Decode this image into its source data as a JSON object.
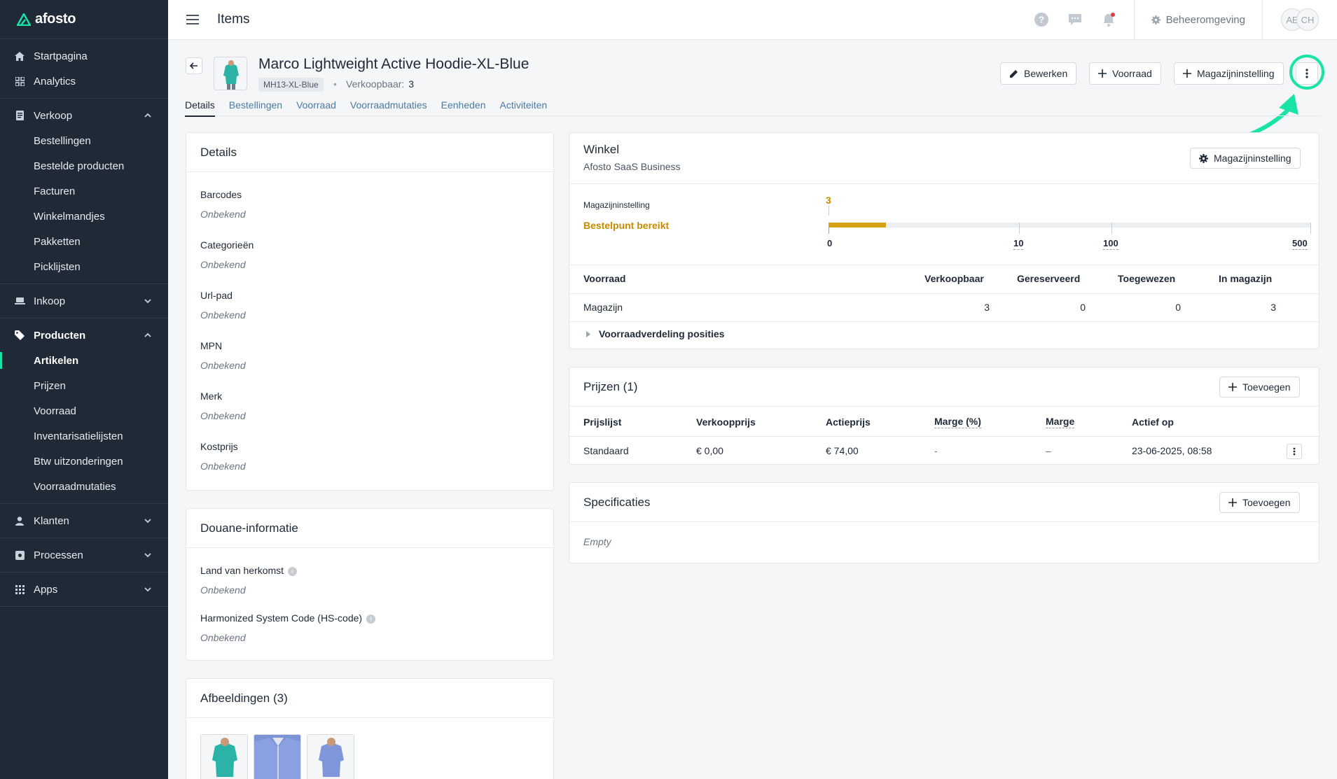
{
  "app": {
    "logo_text": "afosto"
  },
  "sidebar": {
    "items": [
      {
        "label": "Startpagina",
        "icon": "home-icon"
      },
      {
        "label": "Analytics",
        "icon": "analytics-icon"
      },
      {
        "label": "Verkoop",
        "icon": "receipt-icon",
        "expanded": true
      },
      {
        "label": "Bestellingen"
      },
      {
        "label": "Bestelde producten"
      },
      {
        "label": "Facturen"
      },
      {
        "label": "Winkelmandjes"
      },
      {
        "label": "Pakketten"
      },
      {
        "label": "Picklijsten"
      },
      {
        "label": "Inkoop",
        "icon": "truck-icon",
        "expanded": false
      },
      {
        "label": "Producten",
        "icon": "tag-icon",
        "expanded": true
      },
      {
        "label": "Artikelen",
        "active": true
      },
      {
        "label": "Prijzen"
      },
      {
        "label": "Voorraad"
      },
      {
        "label": "Inventarisatielijsten"
      },
      {
        "label": "Btw uitzonderingen"
      },
      {
        "label": "Voorraadmutaties"
      },
      {
        "label": "Klanten",
        "icon": "user-icon",
        "expanded": false
      },
      {
        "label": "Processen",
        "icon": "process-icon",
        "expanded": false
      },
      {
        "label": "Apps",
        "icon": "apps-icon",
        "expanded": false
      }
    ]
  },
  "topbar": {
    "title": "Items",
    "environment": "Beheeromgeving",
    "avatars": [
      "AE",
      "CH"
    ],
    "colors": {
      "notification_dot": "#e53e3e"
    }
  },
  "product": {
    "title": "Marco Lightweight Active Hoodie-XL-Blue",
    "sku": "MH13-XL-Blue",
    "sellable_label": "Verkoopbaar:",
    "sellable_value": "3"
  },
  "header_buttons": {
    "edit": "Bewerken",
    "stock": "Voorraad",
    "warehouse": "Magazijninstelling"
  },
  "tabs": [
    "Details",
    "Bestellingen",
    "Voorraad",
    "Voorraadmutaties",
    "Eenheden",
    "Activiteiten"
  ],
  "details": {
    "title": "Details",
    "fields": [
      {
        "label": "Barcodes",
        "value": "Onbekend"
      },
      {
        "label": "Categorieën",
        "value": "Onbekend"
      },
      {
        "label": "Url-pad",
        "value": "Onbekend"
      },
      {
        "label": "MPN",
        "value": "Onbekend"
      },
      {
        "label": "Merk",
        "value": "Onbekend"
      },
      {
        "label": "Kostprijs",
        "value": "Onbekend"
      }
    ]
  },
  "customs": {
    "title": "Douane-informatie",
    "fields": [
      {
        "label": "Land van herkomst",
        "value": "Onbekend"
      },
      {
        "label": "Harmonized System Code (HS-code)",
        "value": "Onbekend"
      }
    ]
  },
  "images": {
    "title": "Afbeeldingen (3)"
  },
  "shop": {
    "title": "Winkel",
    "subtitle": "Afosto SaaS Business",
    "button": "Magazijninstelling",
    "setting_label": "Magazijninstelling",
    "status": "Bestelpunt bereikt",
    "current": "3",
    "scale": [
      "0",
      "10",
      "100",
      "500"
    ],
    "colors": {
      "status": "#c68a00",
      "bar": "#d4a012"
    },
    "table": {
      "headers": [
        "Voorraad",
        "Verkoopbaar",
        "Gereserveerd",
        "Toegewezen",
        "In magazijn"
      ],
      "rows": [
        [
          "Magazijn",
          "3",
          "0",
          "0",
          "3"
        ]
      ],
      "expand_label": "Voorraadverdeling posities"
    }
  },
  "prices": {
    "title": "Prijzen (1)",
    "add_button": "Toevoegen",
    "headers": [
      "Prijslijst",
      "Verkoopprijs",
      "Actieprijs",
      "Marge (%)",
      "Marge",
      "Actief op"
    ],
    "rows": [
      [
        "Standaard",
        "€ 0,00",
        "€ 74,00",
        "-",
        "–",
        "23-06-2025, 08:58"
      ]
    ]
  },
  "specs": {
    "title": "Specificaties",
    "add_button": "Toevoegen",
    "empty": "Empty"
  },
  "accent_color": "#19e3a6"
}
